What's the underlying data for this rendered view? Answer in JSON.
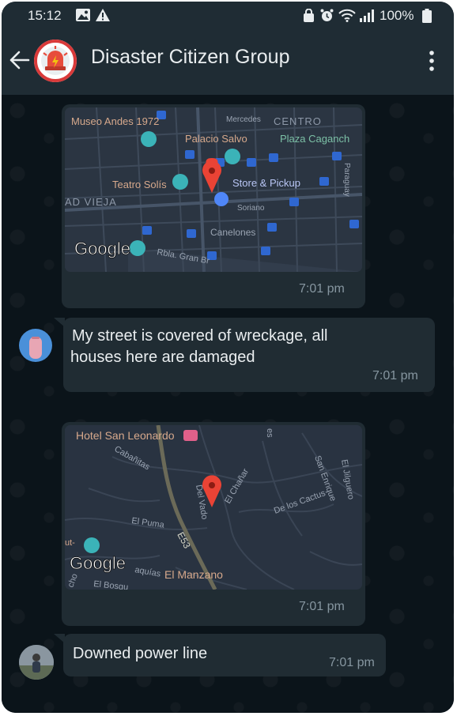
{
  "status_bar": {
    "time": "15:12",
    "battery": "100%"
  },
  "header": {
    "title": "Disaster Citizen Group"
  },
  "map1": {
    "labels": {
      "museo": "Museo Andes 1972",
      "mercedes": "Mercedes",
      "centro": "CENTRO",
      "palacio": "Palacio Salvo",
      "plaza": "Plaza Caganch",
      "teatro": "Teatro Solís",
      "store": "Store & Pickup",
      "vieja": "AD VIEJA",
      "soriano": "Soriano",
      "paraguay": "Paraguay",
      "canelones": "Canelones",
      "rbla": "Rbla. Gran Br",
      "google": "Google"
    },
    "time": "7:01 pm"
  },
  "message1": {
    "text_line1": "My street is covered of wreckage, all",
    "text_line2": "houses here are damaged",
    "time": "7:01 pm"
  },
  "map2": {
    "labels": {
      "hotel": "Hotel San Leonardo",
      "cabanitas": "Cabañitas",
      "es": "es",
      "sanenrique": "San Enrique",
      "jilguero": "El Jilguero",
      "delvado": "Del Vado",
      "chanar": "El Chañar",
      "cactus": "De los Cactus",
      "puma": "El Puma",
      "e53": "E53",
      "ut": "ut-",
      "google": "Google",
      "aquias": "aquías",
      "manzano": "El Manzano",
      "bosque": "El Bosqu",
      "cho": "cho"
    },
    "time": "7:01 pm"
  },
  "message2": {
    "text": "Downed power line",
    "time": "7:01 pm"
  },
  "colors": {
    "bar": "#1f2c34",
    "bubble": "#202c33",
    "chat_bg": "#0b141a",
    "pin": "#ea4335"
  }
}
